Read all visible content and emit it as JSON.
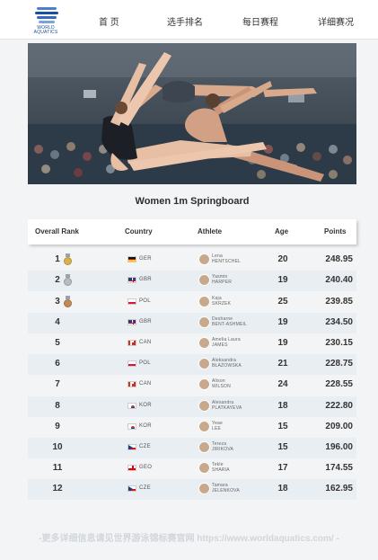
{
  "header": {
    "logo": {
      "line1": "WORLD",
      "line2": "AQUATICS"
    },
    "nav": [
      "首 页",
      "选手排名",
      "每日赛程",
      "详细赛况"
    ]
  },
  "event_title": "Women 1m Springboard",
  "table": {
    "columns": [
      "Overall Rank",
      "Country",
      "Athlete",
      "Age",
      "Points"
    ],
    "rows": [
      {
        "rank": "1",
        "medal": "gold",
        "country": "GER",
        "athlete_line1": "Lena",
        "athlete_line2": "HENTSCHEL",
        "age": "20",
        "points": "248.95"
      },
      {
        "rank": "2",
        "medal": "silver",
        "country": "GBR",
        "athlete_line1": "Yasmin",
        "athlete_line2": "HARPER",
        "age": "19",
        "points": "240.40"
      },
      {
        "rank": "3",
        "medal": "bronze",
        "country": "POL",
        "athlete_line1": "Kaja",
        "athlete_line2": "SKRZEK",
        "age": "25",
        "points": "239.85"
      },
      {
        "rank": "4",
        "medal": "",
        "country": "GBR",
        "athlete_line1": "Desharne",
        "athlete_line2": "BENT-ASHMEIL",
        "age": "19",
        "points": "234.50"
      },
      {
        "rank": "5",
        "medal": "",
        "country": "CAN",
        "athlete_line1": "Amelia Laura",
        "athlete_line2": "JAMES",
        "age": "19",
        "points": "230.15"
      },
      {
        "rank": "6",
        "medal": "",
        "country": "POL",
        "athlete_line1": "Aleksandra",
        "athlete_line2": "BŁAŻOWSKA",
        "age": "21",
        "points": "228.75"
      },
      {
        "rank": "7",
        "medal": "",
        "country": "CAN",
        "athlete_line1": "Alison",
        "athlete_line2": "WILSON",
        "age": "24",
        "points": "228.55"
      },
      {
        "rank": "8",
        "medal": "",
        "country": "KOR",
        "athlete_line1": "Alexandra",
        "athlete_line2": "PLATKAYEVA",
        "age": "18",
        "points": "222.80"
      },
      {
        "rank": "9",
        "medal": "",
        "country": "KOR",
        "athlete_line1": "Yeae",
        "athlete_line2": "LEE",
        "age": "15",
        "points": "209.00"
      },
      {
        "rank": "10",
        "medal": "",
        "country": "CZE",
        "athlete_line1": "Tereza",
        "athlete_line2": "JIRIKOVA",
        "age": "15",
        "points": "196.00"
      },
      {
        "rank": "11",
        "medal": "",
        "country": "GEO",
        "athlete_line1": "Tekle",
        "athlete_line2": "SHARIA",
        "age": "17",
        "points": "174.55"
      },
      {
        "rank": "12",
        "medal": "",
        "country": "CZE",
        "athlete_line1": "Tamara",
        "athlete_line2": "JELENKOVA",
        "age": "18",
        "points": "162.95"
      }
    ]
  },
  "footer_text": "-更多详细信息请见世界游泳锦标赛官网    https://www.worldaquatics.com/ -",
  "colors": {
    "page_bg": "#f2f4f6",
    "row_alt": "#e9eef3",
    "gold": "#d9b24c",
    "silver": "#b8bcc2",
    "bronze": "#c08a55",
    "brand": "#1a4fa0"
  }
}
